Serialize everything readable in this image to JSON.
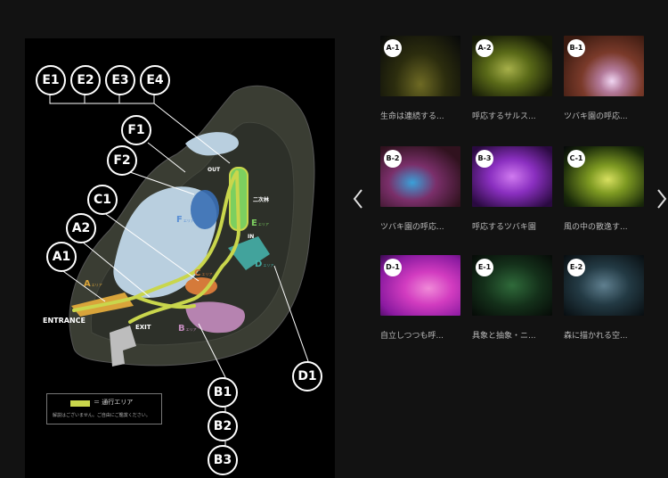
{
  "map": {
    "callouts": {
      "e1": "E1",
      "e2": "E2",
      "e3": "E3",
      "e4": "E4",
      "f1": "F1",
      "f2": "F2",
      "c1": "C1",
      "a2": "A2",
      "a1": "A1",
      "d1": "D1",
      "b1": "B1",
      "b2": "B2",
      "b3": "B3"
    },
    "labels": {
      "entrance": "ENTRANCE",
      "exit": "EXIT",
      "out": "OUT",
      "in": "IN",
      "forest": "二次林",
      "zone_a": "A",
      "zone_b": "B",
      "zone_c": "C",
      "zone_d": "D",
      "zone_e": "E",
      "zone_f": "F",
      "area_suffix": "エリア"
    },
    "legend": {
      "text": "＝ 通行エリア",
      "note": "解説はございません。ご自由にご鑑賞ください。"
    }
  },
  "gallery": {
    "items": [
      {
        "badge": "A-1",
        "caption": "生命は連続する..."
      },
      {
        "badge": "A-2",
        "caption": "呼応するサルス..."
      },
      {
        "badge": "B-1",
        "caption": "ツバキ園の呼応..."
      },
      {
        "badge": "B-2",
        "caption": "ツバキ園の呼応..."
      },
      {
        "badge": "B-3",
        "caption": "呼応するツバキ園"
      },
      {
        "badge": "C-1",
        "caption": "風の中の散逸す..."
      },
      {
        "badge": "D-1",
        "caption": "自立しつつも呼..."
      },
      {
        "badge": "E-1",
        "caption": "具象と抽象・ニ..."
      },
      {
        "badge": "E-2",
        "caption": "森に描かれる空..."
      }
    ],
    "prev_icon": "chevron-left-icon",
    "next_icon": "chevron-right-icon"
  },
  "colors": {
    "path": "#c9d64c",
    "zone_a": "#d9a43a",
    "zone_b": "#c58dbf",
    "zone_c": "#d57a3a",
    "zone_d": "#45b0a8",
    "zone_e": "#7ccf5f",
    "zone_f": "#3a6fb5",
    "pond": "#b9cfdf"
  }
}
